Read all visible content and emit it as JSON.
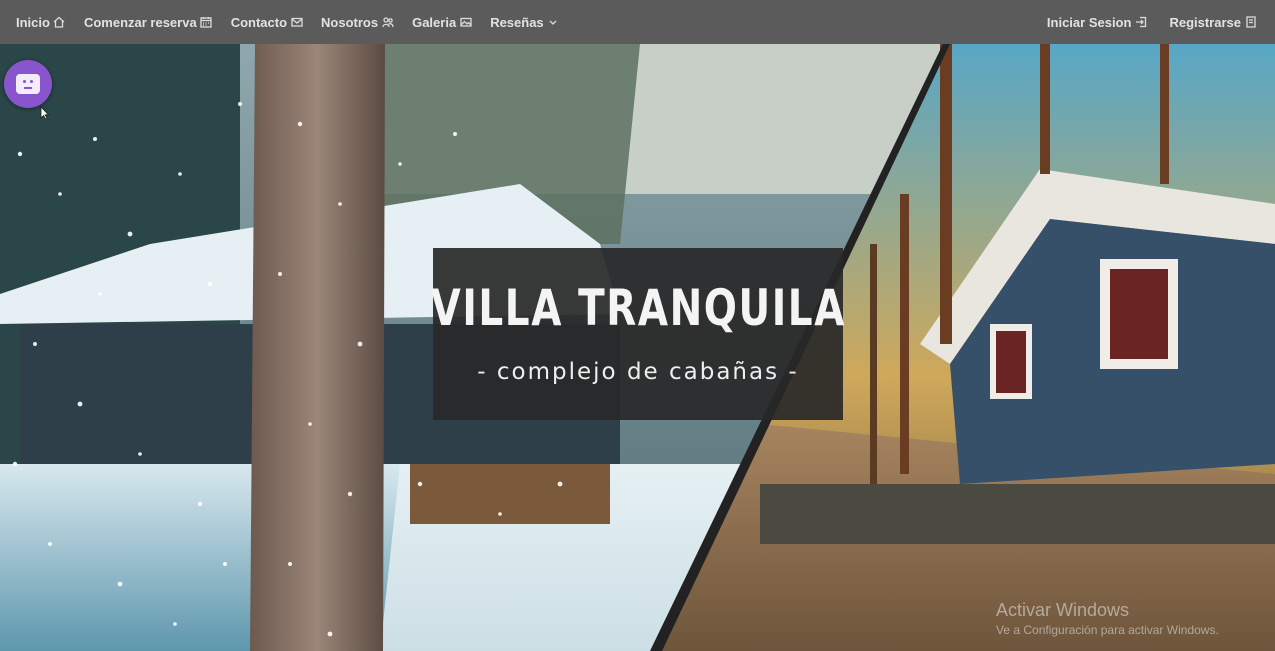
{
  "nav": {
    "left": [
      {
        "label": "Inicio",
        "icon": "home-icon"
      },
      {
        "label": "Comenzar reserva",
        "icon": "calendar-icon"
      },
      {
        "label": "Contacto",
        "icon": "mail-icon"
      },
      {
        "label": "Nosotros",
        "icon": "people-icon"
      },
      {
        "label": "Galeria",
        "icon": "image-icon"
      },
      {
        "label": "Reseñas",
        "icon": "chevron-down-icon"
      }
    ],
    "right": [
      {
        "label": "Iniciar Sesion",
        "icon": "login-icon"
      },
      {
        "label": "Registrarse",
        "icon": "register-icon"
      }
    ]
  },
  "hero": {
    "title": "VILLA TRANQUILA",
    "subtitle": "- complejo de cabañas -"
  },
  "chat_widget": {
    "icon": "chatbot-icon",
    "color": "#8855cc"
  },
  "watermark": {
    "title": "Activar Windows",
    "subtitle": "Ve a Configuración para activar Windows."
  },
  "colors": {
    "navbar": "#5b5b5b",
    "title_box": "#282828",
    "nav_text": "#e2e2e2"
  }
}
